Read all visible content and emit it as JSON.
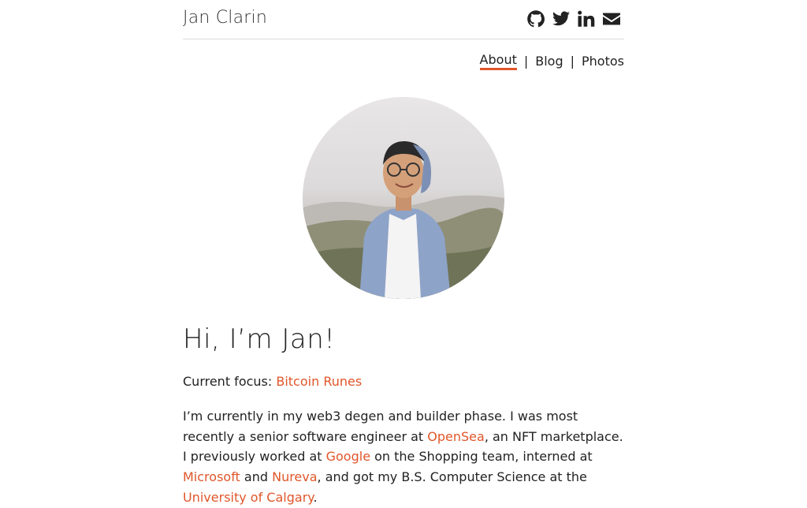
{
  "header": {
    "site_title": "Jan Clarin",
    "social": [
      {
        "name": "github-icon"
      },
      {
        "name": "twitter-icon"
      },
      {
        "name": "linkedin-icon"
      },
      {
        "name": "email-icon"
      }
    ]
  },
  "nav": {
    "items": [
      "About",
      "Blog",
      "Photos"
    ],
    "separator": "|",
    "active": "About"
  },
  "main": {
    "headline": "Hi, I’m Jan!",
    "focus_label": "Current focus:",
    "focus_link": "Bitcoin Runes",
    "bio": {
      "t1": "I’m currently in my web3 degen and builder phase. I was most recently a senior software engineer at ",
      "l1": "OpenSea",
      "t2": ", an NFT marketplace. I previously worked at ",
      "l2": "Google",
      "t3": " on the Shopping team, interned at ",
      "l3": "Microsoft",
      "t4": " and ",
      "l4": "Nureva",
      "t5": ", and got my B.S. Computer Science at the ",
      "l5": "University of Calgary",
      "t6": "."
    }
  },
  "colors": {
    "accent": "#e0562a",
    "text": "#222222",
    "divider": "#dcdcdc"
  }
}
